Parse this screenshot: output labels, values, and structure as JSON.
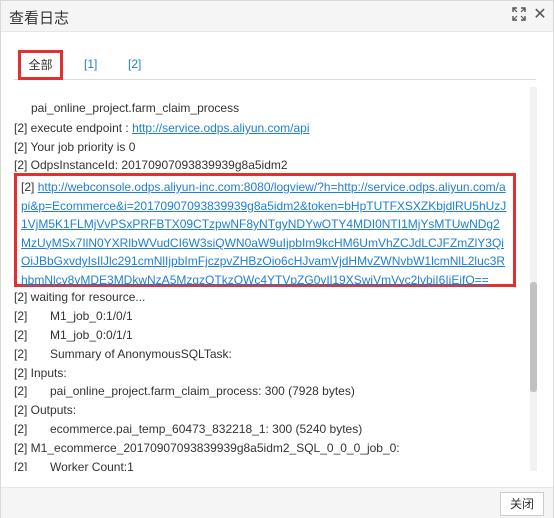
{
  "dialog": {
    "title": "查看日志",
    "close_label": "关闭"
  },
  "tabs": [
    "全部",
    "[1]",
    "[2]"
  ],
  "log": {
    "l0": "pai_online_project.farm_claim_process",
    "l1_pre": "[2] execute endpoint : ",
    "l1_link": "http://service.odps.aliyun.com/api",
    "l2": "[2] Your job priority is 0",
    "l3": "[2] OdpsInstanceId: 20170907093839939g8a5idm2",
    "hl_pre": "[2] ",
    "hl_link": "http://webconsole.odps.aliyun-inc.com:8080/logview/?h=http://service.odps.aliyun.com/api&p=Ecommerce&i=20170907093839939g8a5idm2&token=bHpTUTFXSXZKbjdlRU5hUzJ1VjM5K1FLMjVvPSxPRFBTX09CTzpwNF8yNTgyNDYwOTY4MDI0NTI1MjYsMTUwNDg2MzUyMSx7IlN0YXRlbWVudCI6W3siQWN0aW9uIjpbIm9kcHM6UmVhZCJdLCJFZmZlY3QiOiJBbGxvdyIsIlJlc291cmNlIjpbImFjczpvZHBzOio6cHJvamVjdHMvZWNvbW1lcmNlL2luc3RhbmNlcy8yMDE3MDkwNzA5MzgzOTkzOWc4YTVpZG0yIl19XSwiVmVyc2lvbiI6IjEifQ==",
    "l5": "[2] waiting for resource...",
    "l6_pre": "[2]",
    "l6": "M1_job_0:1/0/1",
    "l7_pre": "[2]",
    "l7": "M1_job_0:0/1/1",
    "l8_pre": "[2]",
    "l8": "Summary of AnonymousSQLTask:",
    "l9": "[2] Inputs:",
    "l10_pre": "[2]",
    "l10": "pai_online_project.farm_claim_process: 300 (7928 bytes)",
    "l11": "[2] Outputs:",
    "l12_pre": "[2]",
    "l12": "ecommerce.pai_temp_60473_832218_1: 300 (5240 bytes)",
    "l13": "[2] M1_ecommerce_20170907093839939g8a5idm2_SQL_0_0_0_job_0:",
    "l14_pre": "[2]",
    "l14": "Worker Count:1"
  }
}
